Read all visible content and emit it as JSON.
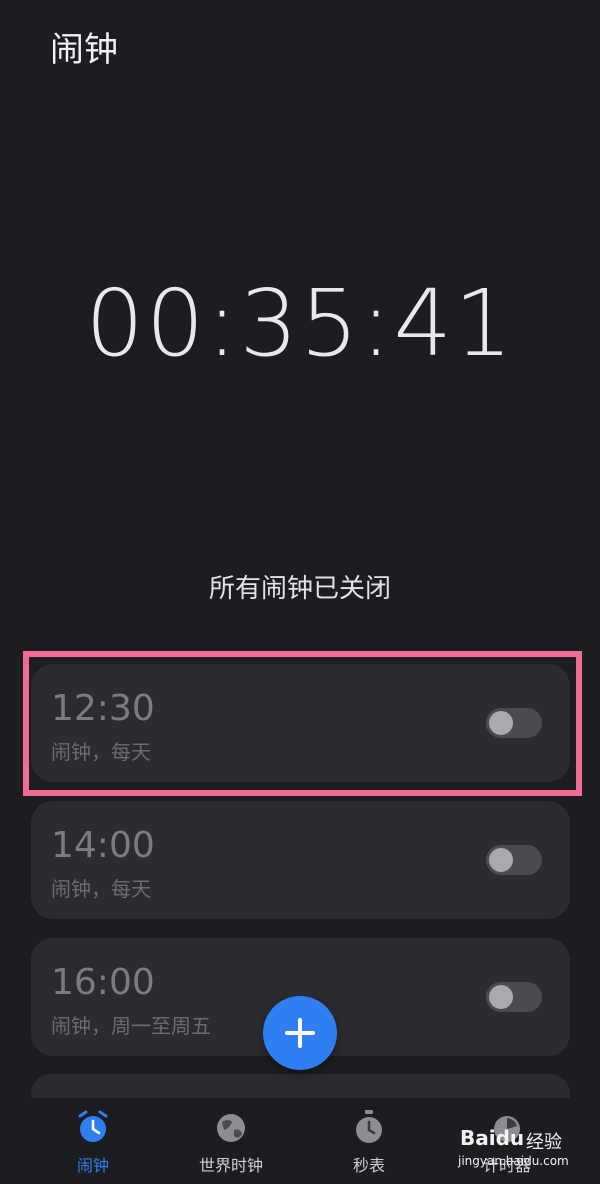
{
  "header": {
    "title": "闹钟"
  },
  "clock": {
    "time": "00:35:41"
  },
  "status_text": "所有闹钟已关闭",
  "alarms": [
    {
      "time": "12:30",
      "description": "闹钟，每天",
      "enabled": false
    },
    {
      "time": "14:00",
      "description": "闹钟，每天",
      "enabled": false
    },
    {
      "time": "16:00",
      "description": "闹钟，周一至周五",
      "enabled": false
    }
  ],
  "fab": {
    "icon": "plus-icon"
  },
  "tabs": [
    {
      "label": "闹钟",
      "icon": "alarm-clock-icon",
      "active": true
    },
    {
      "label": "世界时钟",
      "icon": "globe-icon",
      "active": false
    },
    {
      "label": "秒表",
      "icon": "stopwatch-icon",
      "active": false
    },
    {
      "label": "计时器",
      "icon": "timer-icon",
      "active": false
    }
  ],
  "watermark": {
    "brand": "Baidu",
    "suffix": "经验",
    "url": "jingyan.baidu.com"
  },
  "colors": {
    "accent": "#2f7ff3",
    "highlight": "#f06c94",
    "card": "#2b2c30",
    "background": "#1c1d20"
  }
}
